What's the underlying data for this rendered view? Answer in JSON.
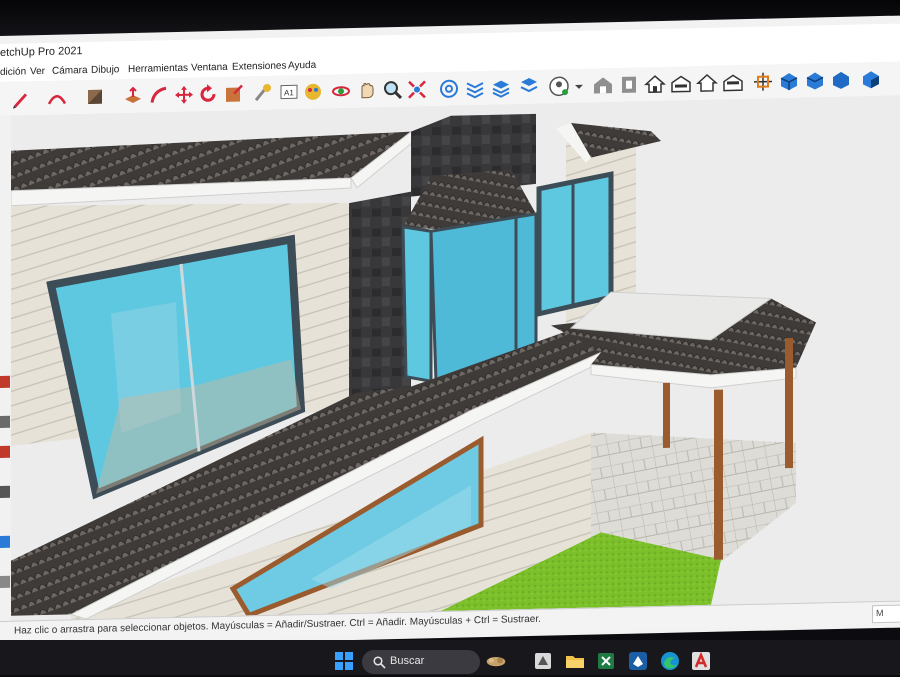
{
  "window": {
    "title": "etchUp Pro 2021"
  },
  "menu": [
    "dición",
    "Ver",
    "Cámara",
    "Dibujo",
    "Herramientas",
    "Ventana",
    "Extensiones",
    "Ayuda"
  ],
  "toolbar_icons": [
    "pencil-icon",
    "arc-icon",
    "paint-bucket-icon",
    "push-pull-icon",
    "follow-me-icon",
    "move-icon",
    "rotate-icon",
    "scale-icon",
    "tape-measure-icon",
    "text-icon",
    "paint-icon",
    "orbit-icon",
    "pan-icon",
    "zoom-icon",
    "zoom-extents-icon",
    "warehouse-icon",
    "components-icon",
    "layers-icon",
    "styles-icon",
    "user-account-icon",
    "iso-view-icon",
    "top-view-icon",
    "front-view-icon",
    "right-view-icon",
    "back-view-icon",
    "left-view-icon",
    "section-plane-icon",
    "display-section-icon",
    "section-cuts-icon",
    "section-fill-icon",
    "shadows-icon"
  ],
  "status": {
    "hint": "Haz clic o arrastra para seleccionar objetos. Mayúsculas = Añadir/Sustraer. Ctrl = Añadir. Mayúsculas + Ctrl = Sustraer.",
    "measurement_label": "M"
  },
  "taskbar": {
    "search_placeholder": "Buscar",
    "apps": [
      "windows-start-icon",
      "search-icon",
      "widgets-icon",
      "sketchup-icon",
      "file-explorer-icon",
      "excel-icon",
      "sketchup-app-icon",
      "edge-icon",
      "autocad-icon"
    ]
  },
  "colors": {
    "wall": "#e6e2d8",
    "glass": "#5ec8e0",
    "roof": "#4a4644",
    "chimney": "#333335",
    "grass": "#7bc02a",
    "paving": "#d9d8d2",
    "post": "#9a5b2e"
  }
}
